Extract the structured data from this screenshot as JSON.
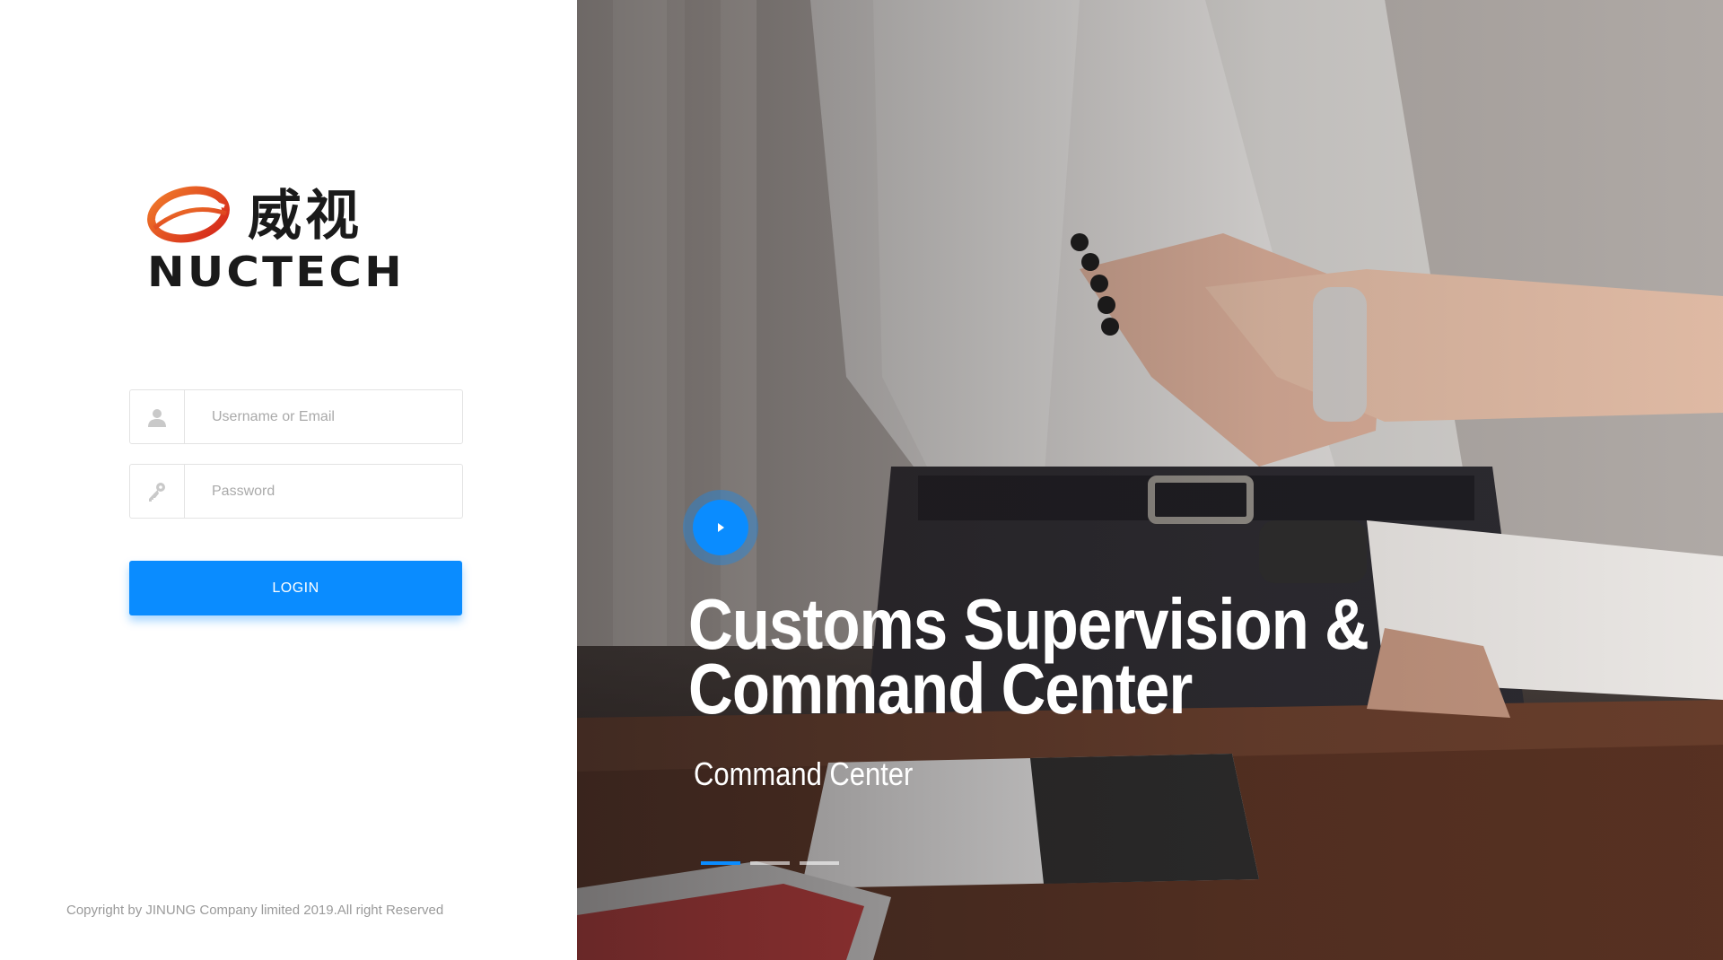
{
  "logo": {
    "chinese_text": "威视",
    "english_text": "NUCTECH",
    "accent_color": "#e8431a"
  },
  "login_form": {
    "username": {
      "placeholder": "Username or Email",
      "value": "",
      "icon": "user-icon"
    },
    "password": {
      "placeholder": "Password",
      "value": "",
      "icon": "key-icon"
    },
    "submit_label": "LOGIN"
  },
  "footer": {
    "copyright": "Copyright by JINUNG Company limited 2019.All right Reserved"
  },
  "hero": {
    "title": "Customs Supervision & Command Center",
    "subtitle": "Command Center",
    "play_icon": "play-icon",
    "slides_count": 3,
    "active_slide": 1
  },
  "colors": {
    "primary": "#0a8cff",
    "border": "#e3e3e3",
    "placeholder": "#aaaaaa",
    "footer_text": "#9a9a9a"
  }
}
